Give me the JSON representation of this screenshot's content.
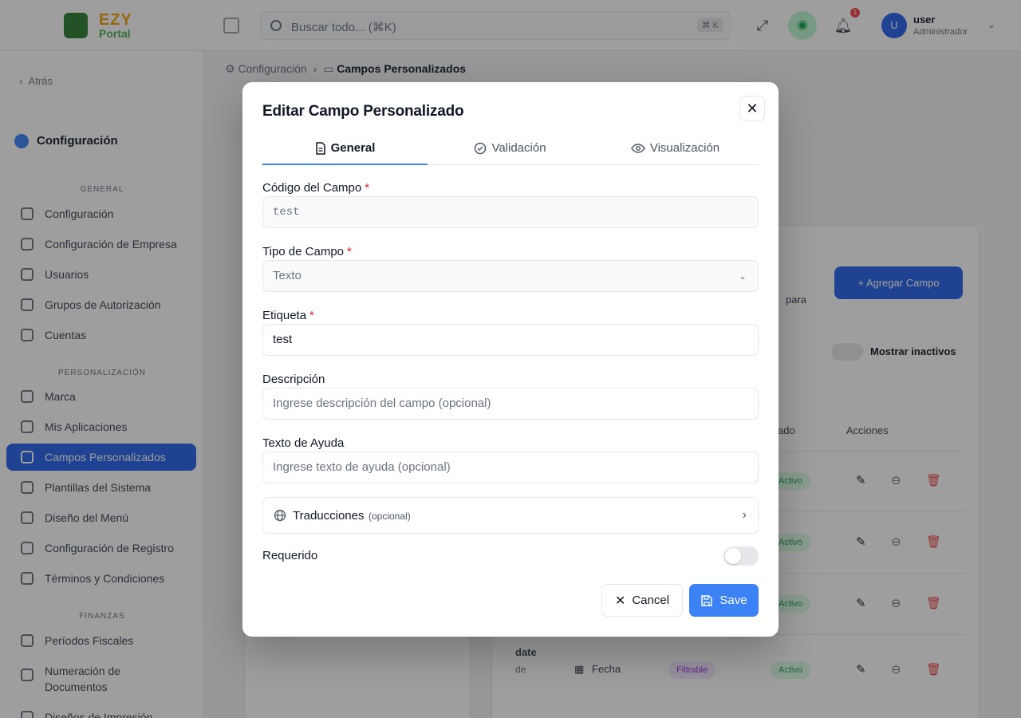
{
  "app": {
    "logo_top": "EZY",
    "logo_bottom": "Portal",
    "search_placeholder": "Buscar todo... (⌘K)",
    "search_kbd": "⌘ K",
    "notification_count": "1",
    "user_initial": "U",
    "user_name": "user",
    "user_role": "Administrador"
  },
  "sidebar": {
    "back_label": "Atrás",
    "title": "Configuración",
    "sections": [
      {
        "label": "GENERAL"
      },
      {
        "label": "PERSONALIZACIÓN"
      },
      {
        "label": "FINANZAS"
      }
    ],
    "items": [
      {
        "label": "Configuración",
        "icon": "settings-icon"
      },
      {
        "label": "Configuración de Empresa",
        "icon": "building-icon"
      },
      {
        "label": "Usuarios",
        "icon": "users-icon"
      },
      {
        "label": "Grupos de Autorización",
        "icon": "shield-icon"
      },
      {
        "label": "Cuentas",
        "icon": "accounts-icon"
      },
      {
        "label": "Marca",
        "icon": "palette-icon"
      },
      {
        "label": "Mis Aplicaciones",
        "icon": "apps-icon"
      },
      {
        "label": "Campos Personalizados",
        "icon": "fields-icon"
      },
      {
        "label": "Plantillas del Sistema",
        "icon": "template-icon"
      },
      {
        "label": "Diseño del Menú",
        "icon": "menu-icon"
      },
      {
        "label": "Configuración de Registro",
        "icon": "user-plus-icon"
      },
      {
        "label": "Términos y Condiciones",
        "icon": "terms-icon"
      },
      {
        "label": "Períodos Fiscales",
        "icon": "calendar-icon"
      },
      {
        "label": "Numeración de Documentos",
        "icon": "document-icon"
      },
      {
        "label": "Diseños de Impresión",
        "icon": "print-icon"
      }
    ]
  },
  "breadcrumb": {
    "parent": "Configuración",
    "current": "Campos Personalizados"
  },
  "background": {
    "add_button": "+ Agregar Campo",
    "partial_text": "para",
    "show_inactive": "Mostrar inactivos",
    "col_status_partial": "ado",
    "col_actions": "Acciones",
    "row_status": "Activo",
    "row4_code": "date",
    "row4_code_sub": "de",
    "row4_type": "Fecha",
    "row4_filter": "Filtrable"
  },
  "modal": {
    "title": "Editar Campo Personalizado",
    "close_icon": "close-icon",
    "tabs": [
      {
        "label": "General",
        "icon": "document-icon",
        "active": true
      },
      {
        "label": "Validación",
        "icon": "check-circle-icon",
        "active": false
      },
      {
        "label": "Visualización",
        "icon": "eye-icon",
        "active": false
      }
    ],
    "fields": {
      "code_label": "Código del Campo",
      "code_value": "test",
      "type_label": "Tipo de Campo",
      "type_value": "Texto",
      "label_label": "Etiqueta",
      "label_value": "test",
      "desc_label": "Descripción",
      "desc_placeholder": "Ingrese descripción del campo (opcional)",
      "help_label": "Texto de Ayuda",
      "help_placeholder": "Ingrese texto de ayuda (opcional)",
      "required_mark": "*"
    },
    "translations": {
      "label": "Traducciones",
      "optional": "(opcional)"
    },
    "required_label": "Requerido",
    "required_on": false,
    "cancel_label": "Cancel",
    "save_label": "Save"
  },
  "colors": {
    "primary": "#3b82f6",
    "sidebar_active": "#2563eb",
    "required": "#dc2626",
    "status_active": "#16a34a"
  }
}
